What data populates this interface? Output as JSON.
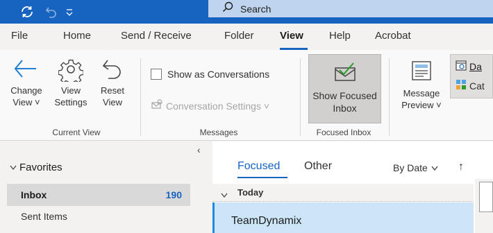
{
  "titlebar": {
    "search_label": "Search"
  },
  "tabs": [
    {
      "label": "File"
    },
    {
      "label": "Home"
    },
    {
      "label": "Send / Receive"
    },
    {
      "label": "Folder"
    },
    {
      "label": "View",
      "active": true
    },
    {
      "label": "Help"
    },
    {
      "label": "Acrobat"
    }
  ],
  "ribbon": {
    "change_view": {
      "line1": "Change",
      "line2": "View ˅"
    },
    "view_settings": {
      "line1": "View",
      "line2": "Settings"
    },
    "reset_view": {
      "line1": "Reset",
      "line2": "View"
    },
    "current_view_group": "Current View",
    "show_as_conversations": "Show as Conversations",
    "conversation_settings": "Conversation Settings ˅",
    "messages_group": "Messages",
    "show_focused": {
      "line1": "Show Focused",
      "line2": "Inbox"
    },
    "focused_group": "Focused Inbox",
    "message_preview": {
      "line1": "Message",
      "line2": "Preview ˅"
    },
    "date_partial": "Da",
    "categories_partial": "Cat"
  },
  "sidebar": {
    "collapse_glyph": "‹",
    "favorites": "Favorites",
    "items": [
      {
        "label": "Inbox",
        "count": "190"
      },
      {
        "label": "Sent Items"
      }
    ]
  },
  "mail": {
    "tabs": [
      {
        "label": "Focused"
      },
      {
        "label": "Other"
      }
    ],
    "sort": "By Date",
    "sort_direction": "↑",
    "group": "Today",
    "messages": [
      {
        "sender": "TeamDynamix"
      }
    ]
  },
  "colors": {
    "brand": "#1664c0",
    "selection": "#cde6f7",
    "count": "#1664c0"
  }
}
